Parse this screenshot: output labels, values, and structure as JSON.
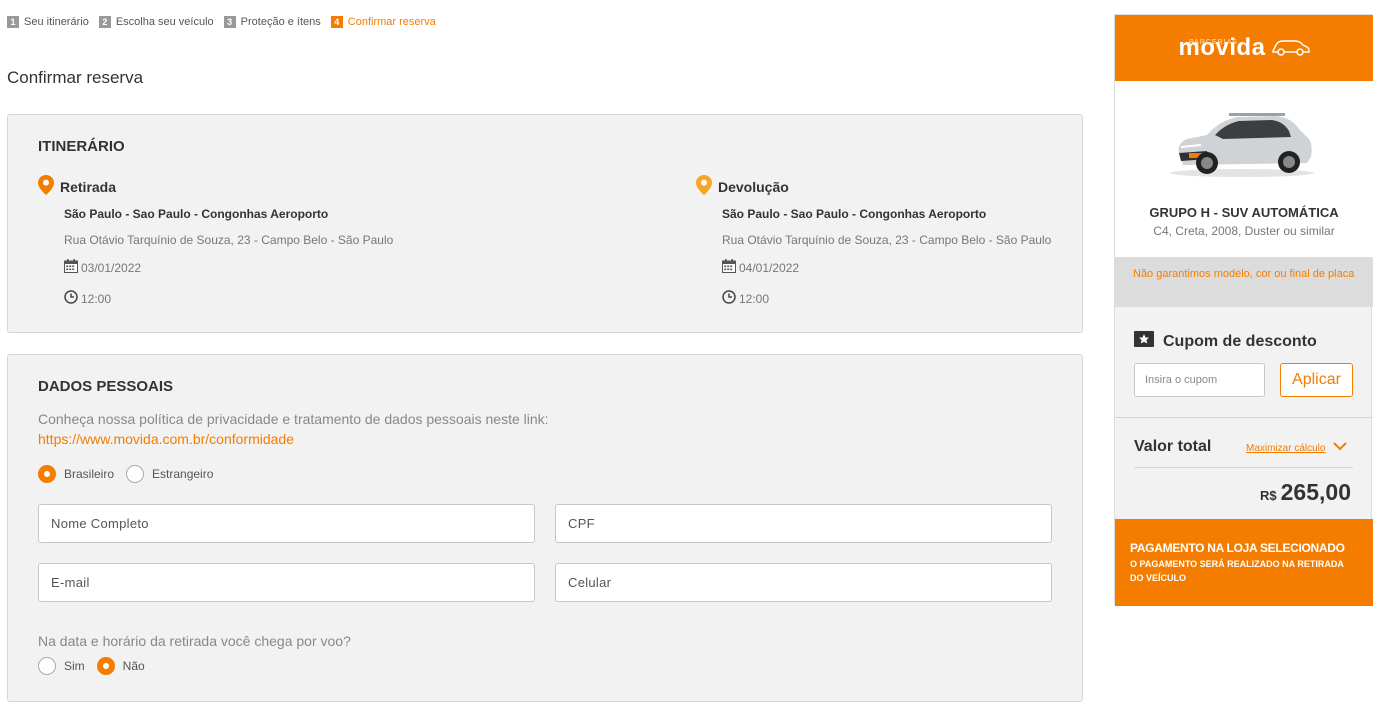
{
  "steps": [
    {
      "num": "1",
      "label": "Seu itinerário"
    },
    {
      "num": "2",
      "label": "Escolha seu veículo"
    },
    {
      "num": "3",
      "label": "Proteção e ítens"
    },
    {
      "num": "4",
      "label": "Confirmar reserva"
    }
  ],
  "page_title": "Confirmar reserva",
  "itinerary": {
    "title": "ITINERÁRIO",
    "pickup": {
      "label": "Retirada",
      "name": "São Paulo - Sao Paulo - Congonhas Aeroporto",
      "address": "Rua Otávio Tarquínio de Souza, 23 - Campo Belo - São Paulo",
      "date": "03/01/2022",
      "time": "12:00"
    },
    "return": {
      "label": "Devolução",
      "name": "São Paulo - Sao Paulo - Congonhas Aeroporto",
      "address": "Rua Otávio Tarquínio de Souza, 23 - Campo Belo - São Paulo",
      "date": "04/01/2022",
      "time": "12:00"
    }
  },
  "personal": {
    "title": "DADOS PESSOAIS",
    "privacy_text": "Conheça nossa política de privacidade e tratamento de dados pessoais neste link:",
    "privacy_link": "https://www.movida.com.br/conformidade",
    "nationality": {
      "option1": "Brasileiro",
      "option2": "Estrangeiro",
      "selected": "Brasileiro"
    },
    "fields": {
      "name_placeholder": "Nome Completo",
      "cpf_placeholder": "CPF",
      "email_placeholder": "E-mail",
      "phone_placeholder": "Celular"
    },
    "flight_question": "Na data e horário da retirada você chega por voo?",
    "flight": {
      "option1": "Sim",
      "option2": "Não",
      "selected": "Não"
    }
  },
  "sidebar": {
    "logo_small": "PARCERIAS",
    "logo": "movida",
    "group": "GRUPO H - SUV AUTOMÁTICA",
    "models": "C4, Creta, 2008, Duster ou similar",
    "notice": "Não garantimos modelo, cor ou final de placa",
    "coupon_title": "Cupom de desconto",
    "coupon_placeholder": "Insira o cupom",
    "coupon_button": "Aplicar",
    "total_label": "Valor total",
    "maximize": "Maximizar cálculo",
    "currency": "R$",
    "total": "265,00",
    "pay_title": "PAGAMENTO NA LOJA SELECIONADO",
    "pay_subtitle": "O PAGAMENTO SERÁ REALIZADO NA RETIRADA DO VEÍCULO"
  },
  "colors": {
    "accent": "#f47d00",
    "pin_return": "#f5a623"
  }
}
